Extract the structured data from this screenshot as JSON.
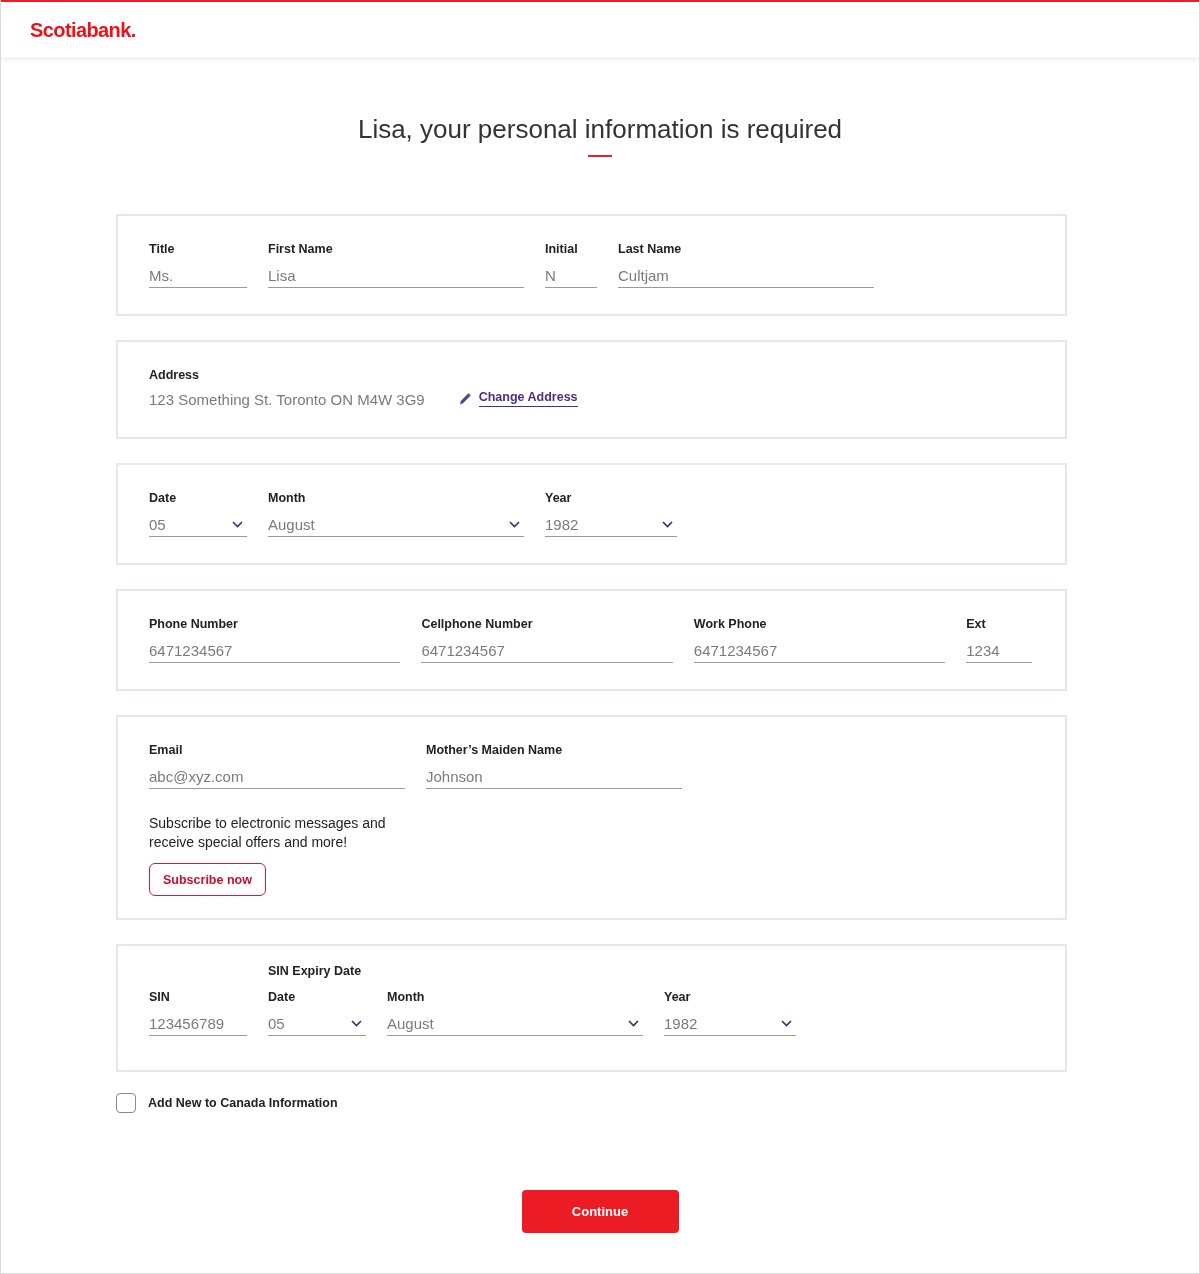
{
  "header": {
    "logo": "Scotiabank."
  },
  "heading": "Lisa, your personal information is required",
  "sections": [
    {
      "kind": "fields",
      "fields": [
        {
          "kind": "text",
          "label": "Title",
          "value": "Ms."
        },
        {
          "kind": "text",
          "label": "First Name",
          "value": "Lisa"
        },
        {
          "kind": "text",
          "label": "Initial",
          "value": "N"
        },
        {
          "kind": "text",
          "label": "Last Name",
          "value": "Cultjam"
        }
      ]
    },
    {
      "kind": "address",
      "label": "Address",
      "value": "123 Something St. Toronto ON M4W 3G9",
      "link": "Change Address"
    },
    {
      "kind": "fields",
      "fields": [
        {
          "kind": "select",
          "label": "Date",
          "value": "05"
        },
        {
          "kind": "select",
          "label": "Month",
          "value": "August"
        },
        {
          "kind": "select",
          "label": "Year",
          "value": "1982"
        }
      ]
    },
    {
      "kind": "fields",
      "fields": [
        {
          "kind": "text",
          "label": "Phone Number",
          "value": "6471234567"
        },
        {
          "kind": "text",
          "label": "Cellphone Number",
          "value": "6471234567"
        },
        {
          "kind": "text",
          "label": "Work Phone",
          "value": "6471234567"
        },
        {
          "kind": "text",
          "label": "Ext",
          "value": "1234"
        }
      ]
    },
    {
      "kind": "fields",
      "fields": [
        {
          "kind": "text",
          "label": "Email",
          "value": "abc@xyz.com"
        },
        {
          "kind": "text",
          "label": "Mother’s Maiden Name",
          "value": "Johnson"
        }
      ],
      "message": "Subscribe to electronic messages and receive special offers and more!",
      "button": "Subscribe now"
    },
    {
      "kind": "grouped",
      "fields": [
        {
          "kind": "text",
          "label": "SIN",
          "value": "123456789"
        }
      ],
      "group": {
        "label": "SIN Expiry Date",
        "fields": [
          {
            "kind": "select",
            "label": "Date",
            "value": "05"
          },
          {
            "kind": "select",
            "label": "Month",
            "value": "August"
          },
          {
            "kind": "select",
            "label": "Year",
            "value": "1982"
          }
        ]
      }
    }
  ],
  "new_to_canada": {
    "label": "Add New to Canada Information",
    "checked": false
  },
  "continue_button": "Continue"
}
